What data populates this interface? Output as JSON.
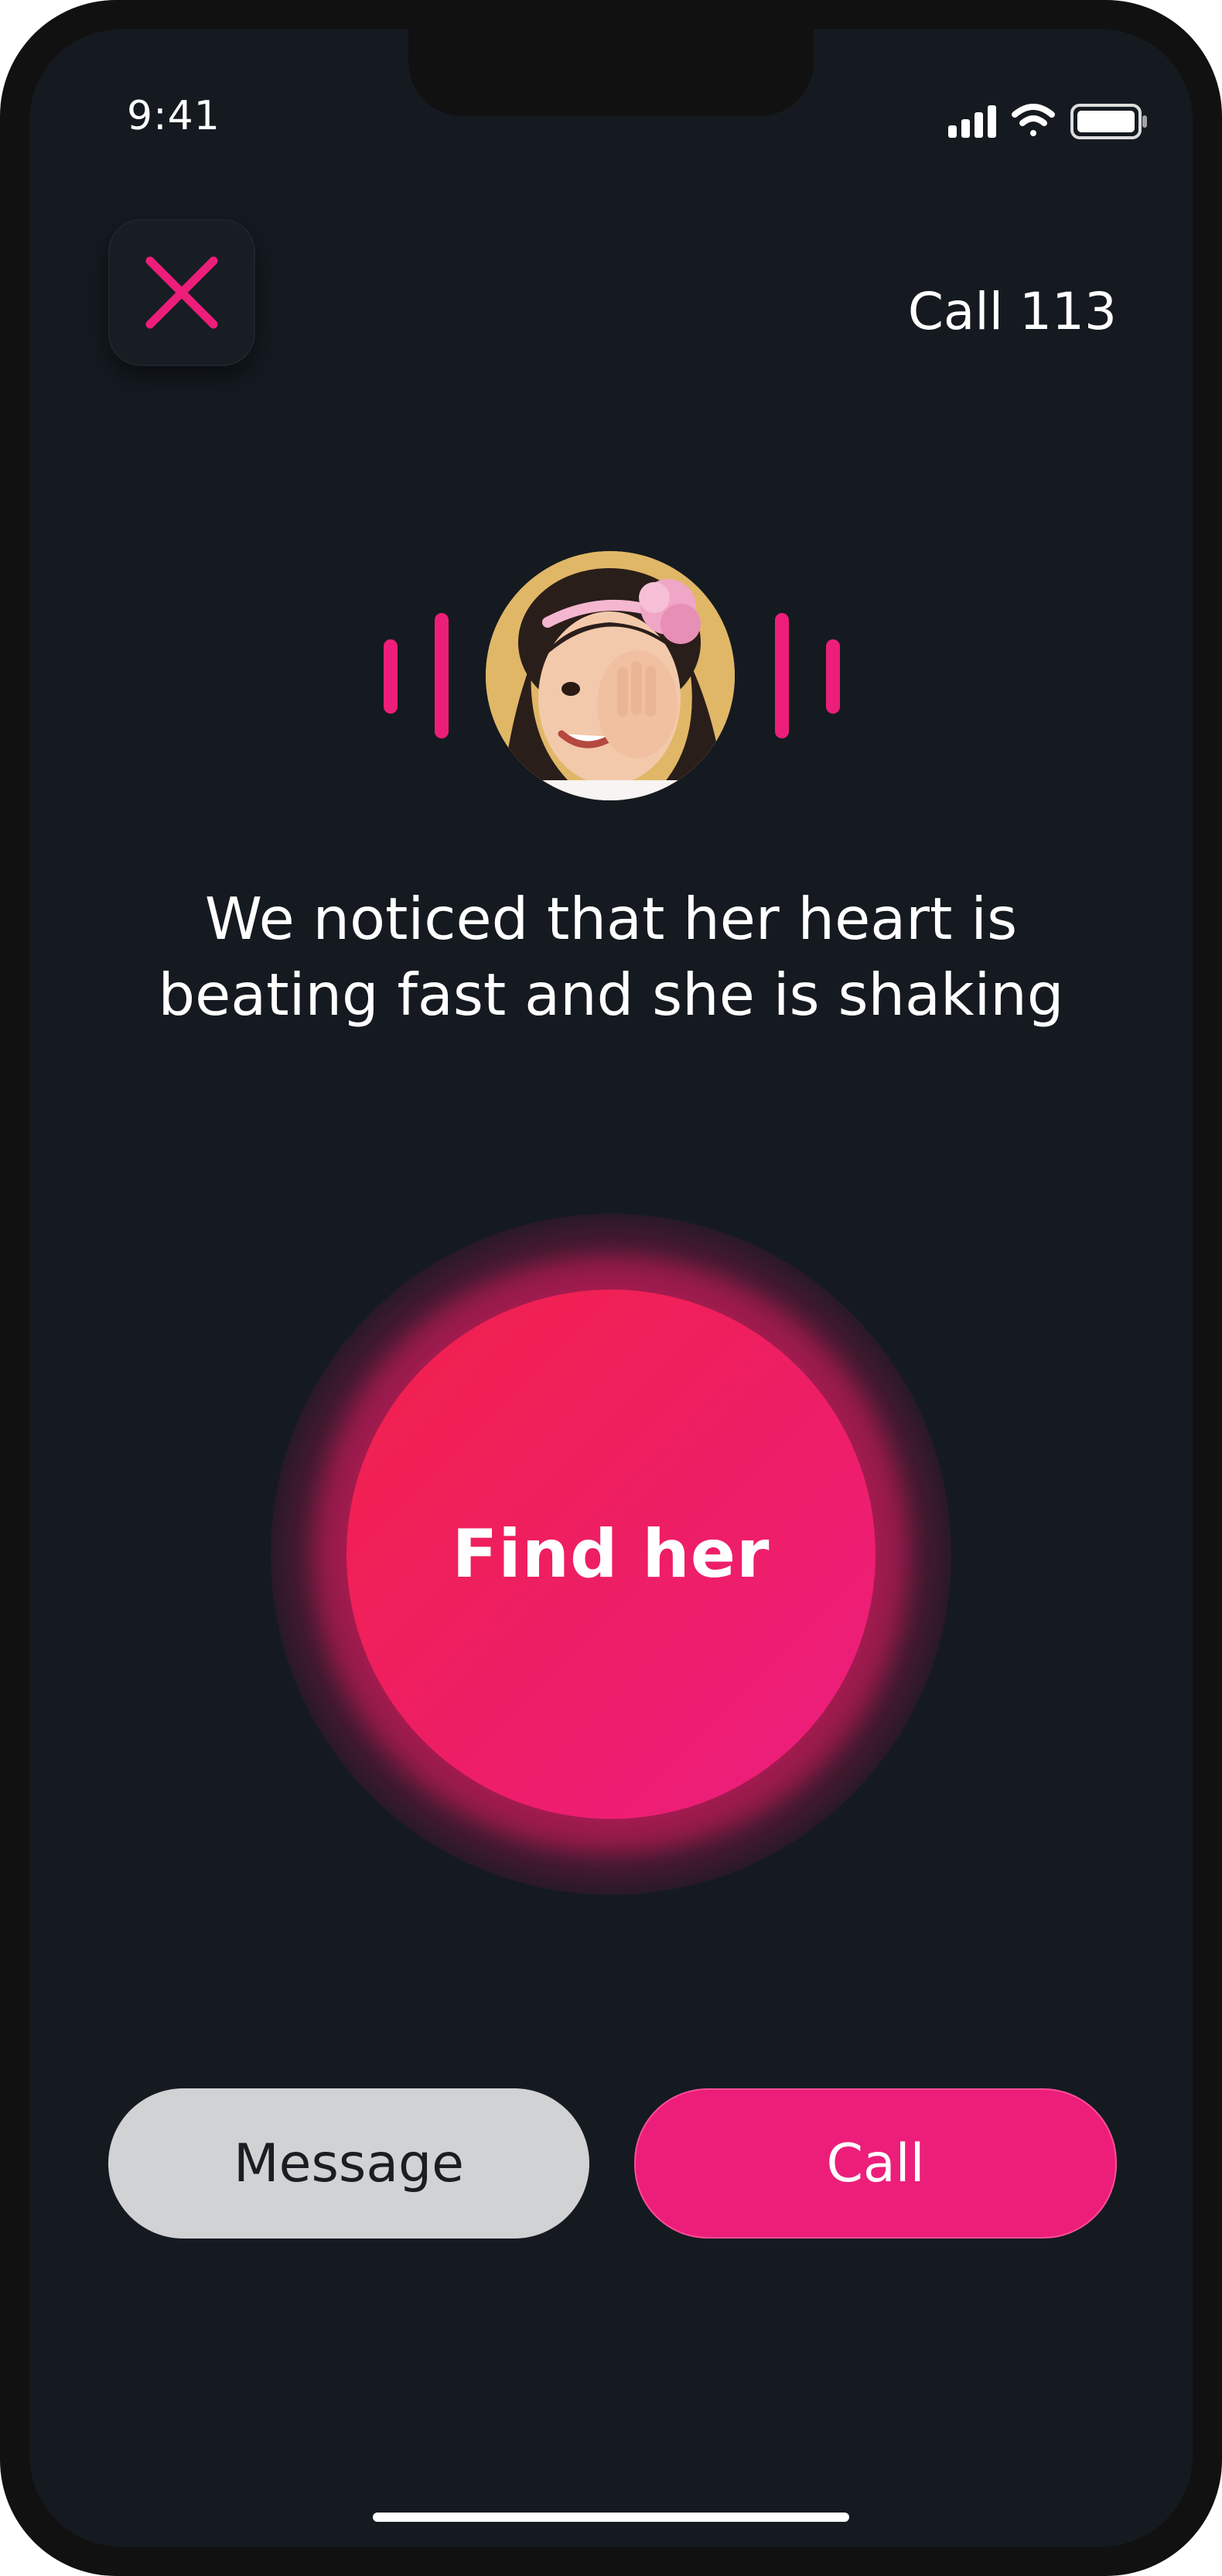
{
  "status_bar": {
    "time": "9:41"
  },
  "header": {
    "close_icon": "close-icon",
    "call_label": "Call 113"
  },
  "profile": {
    "avatar_desc": "avatar",
    "message_line1": "We noticed that her heart is",
    "message_line2": "beating fast and she is shaking"
  },
  "main": {
    "find_label": "Find her"
  },
  "actions": {
    "message_label": "Message",
    "call_label": "Call"
  },
  "colors": {
    "accent": "#ec1e79",
    "background": "#141a20",
    "secondary_button": "#d1d2d4"
  }
}
